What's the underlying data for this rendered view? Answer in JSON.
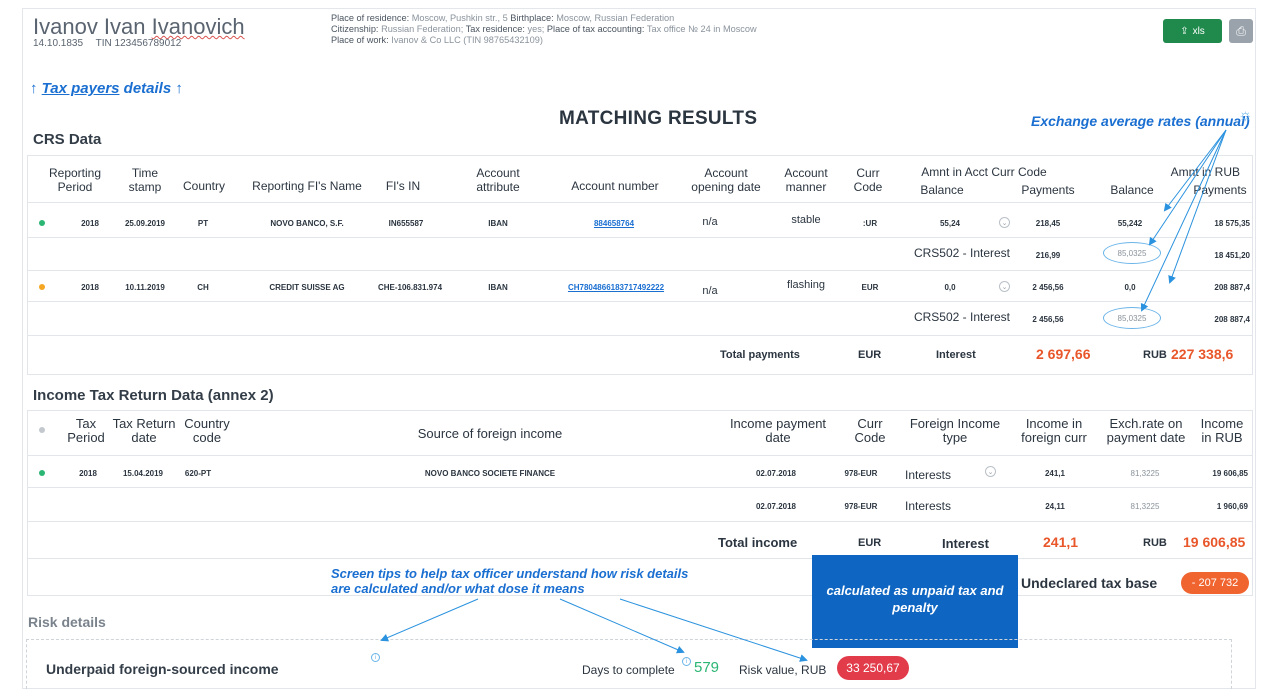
{
  "header": {
    "name_first": "Ivanov Ivan",
    "name_last": "Ivanovich",
    "birth_date": "14.10.1835",
    "tin": "TIN 123456789012",
    "residence_label": "Place of residence:",
    "residence_value": "Moscow, Pushkin str., 5",
    "birthplace_label": "Birthplace:",
    "birthplace_value": "Moscow, Russian Federation",
    "citizenship_label": "Citizenship:",
    "citizenship_value": "Russian Federation;",
    "tax_residence_label": "Tax residence:",
    "tax_residence_value": "yes;",
    "tax_accounting_label": "Place of tax accounting:",
    "tax_accounting_value": "Tax office № 24 in Moscow",
    "work_label": "Place of work:",
    "work_value": "Ivanov & Co LLC (TIN 98765432109)",
    "xls_label": "xls"
  },
  "tax_payers_link": {
    "arrow_left": "↑",
    "link": "Tax payers",
    "rest": "details",
    "arrow_right": "↑"
  },
  "title": "MATCHING RESULTS",
  "exchange_rates_label": "Exchange average rates (annual)",
  "crs": {
    "section": "CRS Data",
    "headers": {
      "period": "Reporting Period",
      "stamp": "Time stamp",
      "country": "Country",
      "fi_name": "Reporting FI's Name",
      "fi_in": "FI's IN",
      "attr": "Account attribute",
      "acct": "Account number",
      "opening": "Account opening date",
      "manner": "Account manner",
      "curr": "Curr Code",
      "amnt_acct": "Amnt in Acct Curr Code",
      "amnt_rub": "Amnt in RUB",
      "balance": "Balance",
      "payments": "Payments",
      "balance2": "Balance",
      "payments2": "Payments"
    },
    "rows": [
      {
        "period": "2018",
        "stamp": "25.09.2019",
        "country": "PT",
        "fi_name": "NOVO BANCO, S.F.",
        "fi_in": "IN655587",
        "attr": "IBAN",
        "acct": "884658764",
        "opening": "n/a",
        "manner": "stable",
        "curr": ":UR",
        "balance": "55,24",
        "payments": "218,45",
        "rub_balance": "55,242",
        "rub_payments": "18 575,35",
        "sub_label": "CRS502 - Interest",
        "sub_payments": "216,99",
        "sub_rate": "85,0325",
        "sub_rub": "18 451,20",
        "dot_color": "#2bb673"
      },
      {
        "period": "2018",
        "stamp": "10.11.2019",
        "country": "CH",
        "fi_name": "CREDIT SUISSE AG",
        "fi_in": "CHE-106.831.974",
        "attr": "IBAN",
        "acct": "CH7804866183717492222",
        "opening": "n/a",
        "manner": "flashing",
        "curr": "EUR",
        "balance": "0,0",
        "payments": "2 456,56",
        "rub_balance": "0,0",
        "rub_payments": "208 887,4",
        "sub_label": "CRS502 - Interest",
        "sub_payments": "2 456,56",
        "sub_rate": "85,0325",
        "sub_rub": "208 887,4",
        "dot_color": "#f5a623"
      }
    ],
    "total": {
      "label": "Total payments",
      "curr": "EUR",
      "type": "Interest",
      "amount": "2 697,66",
      "rub": "RUB",
      "rub_amount": "227 338,6"
    }
  },
  "itr": {
    "section": "Income Tax Return Data (annex 2)",
    "headers": {
      "period": "Tax Period",
      "date": "Tax Return date",
      "country": "Country code",
      "source": "Source of foreign income",
      "pay_date": "Income payment date",
      "curr": "Curr Code",
      "type": "Foreign Income type",
      "income_foreign": "Income in foreign curr",
      "rate": "Exch.rate on payment date",
      "income_rub": "Income in RUB"
    },
    "rows": [
      {
        "period": "2018",
        "date": "15.04.2019",
        "country": "620-PT",
        "source": "NOVO BANCO SOCIETE FINANCE",
        "pay_date": "02.07.2018",
        "curr": "978-EUR",
        "type": "Interests",
        "income": "241,1",
        "rate": "81,3225",
        "rub": "19 606,85"
      },
      {
        "period": "",
        "date": "",
        "country": "",
        "source": "",
        "pay_date": "02.07.2018",
        "curr": "978-EUR",
        "type": "Interests",
        "income": "24,11",
        "rate": "81,3225",
        "rub": "1 960,69"
      }
    ],
    "total": {
      "label": "Total income",
      "curr": "EUR",
      "type": "Interest",
      "amount": "241,1",
      "rub": "RUB",
      "rub_amount": "19 606,85"
    }
  },
  "annotations": {
    "tips": "Screen tips to help tax officer understand how risk details are calculated and/or what dose it means",
    "calculated": "calculated as unpaid tax and penalty"
  },
  "undeclared": {
    "label": "Undeclared tax base",
    "value": "- 207 732"
  },
  "risk": {
    "section": "Risk details",
    "item": "Underpaid foreign-sourced income",
    "days_label": "Days to complete",
    "days_value": "579",
    "risk_label": "Risk value, RUB",
    "risk_value": "33 250,67"
  },
  "colors": {
    "accent": "#1a6fd1",
    "green": "#1f8a4c",
    "orange": "#e8562a",
    "danger": "#e23b4a"
  }
}
